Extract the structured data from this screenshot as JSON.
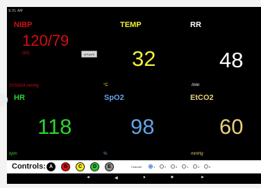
{
  "status_bar": {
    "time": "9:31 AM"
  },
  "vitals": {
    "nibp": {
      "label": "NIBP",
      "value": "120/79",
      "mean": "(92)",
      "unit": "SYS/DIA mmHg"
    },
    "temp": {
      "label": "TEMP",
      "value": "32",
      "unit": "°C"
    },
    "rr": {
      "label": "RR",
      "value": "48",
      "unit": "/min"
    },
    "hr": {
      "label": "HR",
      "value": "118",
      "unit": "bpm"
    },
    "spo2": {
      "label": "SpO2",
      "value": "98",
      "unit": "%"
    },
    "etco2": {
      "label": "EtCO2",
      "value": "60",
      "unit": "mmHg"
    }
  },
  "update_button": {
    "label": "UPDATE"
  },
  "controls": {
    "label": "Controls:",
    "buttons": [
      {
        "letter": "A",
        "color": "#000000",
        "text_color": "#ffffff"
      },
      {
        "letter": "B",
        "color": "#e01010",
        "text_color": "#000000"
      },
      {
        "letter": "C",
        "color": "#f2ee1c",
        "text_color": "#000000"
      },
      {
        "letter": "D",
        "color": "#2dc72d",
        "text_color": "#000000"
      },
      {
        "letter": "E",
        "color": "#8c8c8c",
        "text_color": "#000000"
      }
    ],
    "channel_label": "Channel",
    "channels": [
      "1",
      "2",
      "3",
      "4",
      "5",
      "6"
    ],
    "selected_channel": "1"
  },
  "nav": {
    "icons": [
      "volume-down-icon",
      "back-icon",
      "home-icon",
      "recents-icon",
      "volume-up-icon"
    ]
  },
  "colors": {
    "nibp": "#d50f12",
    "temp": "#f3f033",
    "rr": "#ffffff",
    "hr": "#2ed32e",
    "spo2": "#63a3e5",
    "etco2": "#e6cf7d"
  }
}
